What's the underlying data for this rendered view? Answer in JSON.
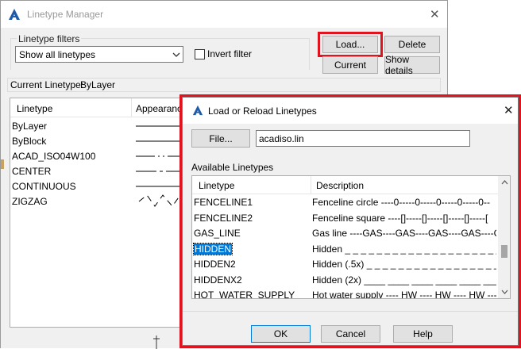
{
  "main_window": {
    "title": "Linetype Manager",
    "close_glyph": "✕",
    "filters_group": "Linetype filters",
    "filter_select": "Show all linetypes",
    "invert_filter": "Invert filter",
    "load_button": "Load...",
    "delete_button": "Delete",
    "current_button": "Current",
    "details_button": "Show details",
    "current_linetype_label": "Current Linetype:",
    "current_linetype_value": "ByLayer",
    "columns": [
      "Linetype",
      "Appearance"
    ],
    "rows": [
      "ByLayer",
      "ByBlock",
      "ACAD_ISO04W100",
      "CENTER",
      "CONTINUOUS",
      "ZIGZAG"
    ]
  },
  "load_dialog": {
    "title": "Load or Reload Linetypes",
    "close_glyph": "✕",
    "file_button": "File...",
    "file_value": "acadiso.lin",
    "available_label": "Available Linetypes",
    "columns": [
      "Linetype",
      "Description"
    ],
    "rows": [
      {
        "name": "FENCELINE1",
        "desc": "Fenceline circle ----0-----0-----0-----0-----0--",
        "selected": false
      },
      {
        "name": "FENCELINE2",
        "desc": "Fenceline square ----[]-----[]-----[]-----[]-----[",
        "selected": false
      },
      {
        "name": "GAS_LINE",
        "desc": "Gas line ----GAS----GAS----GAS----GAS----GA",
        "selected": false
      },
      {
        "name": "HIDDEN",
        "desc": "Hidden _ _ _ _ _ _ _ _ _ _ _ _ _ _ _ _ _ _ _ _ _",
        "selected": true
      },
      {
        "name": "HIDDEN2",
        "desc": "Hidden (.5x) _ _ _ _ _ _ _ _ _ _ _ _ _ _ _ _ _ _ _",
        "selected": false
      },
      {
        "name": "HIDDENX2",
        "desc": "Hidden (2x) ____ ____ ____ ____ ____ ____ ____",
        "selected": false
      },
      {
        "name": "HOT_WATER_SUPPLY",
        "desc": "Hot water supply ---- HW ---- HW ---- HW ----",
        "selected": false
      }
    ],
    "ok_button": "OK",
    "cancel_button": "Cancel",
    "help_button": "Help"
  },
  "colors": {
    "highlight": "#e0141e",
    "selection": "#0078d7",
    "button_face": "#e1e1e1",
    "dialog_bg": "#f0f0f0"
  }
}
